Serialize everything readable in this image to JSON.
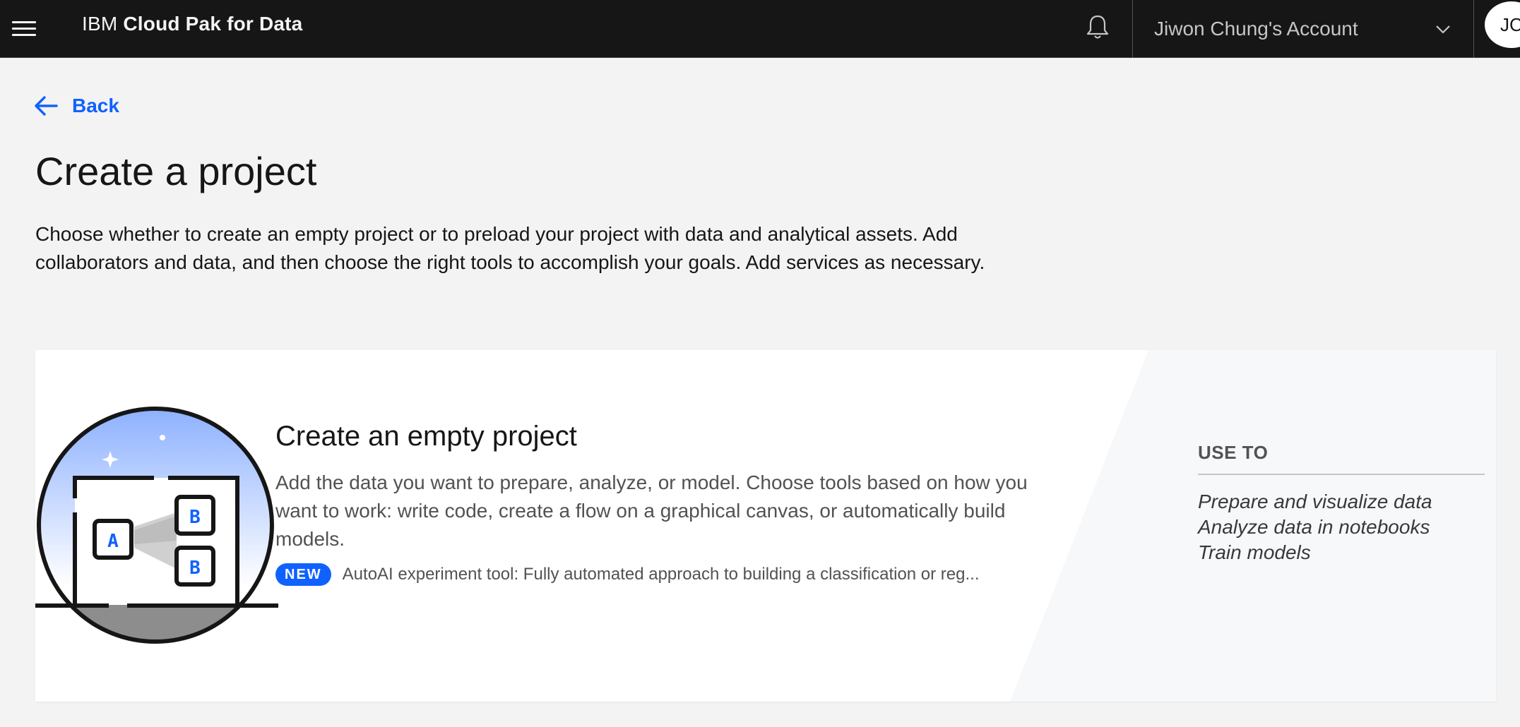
{
  "header": {
    "brand_light": "IBM",
    "brand_bold": "Cloud Pak for Data",
    "account": "Jiwon Chung's Account",
    "avatar_initials": "JC",
    "icons": {
      "menu": "hamburger-menu-icon",
      "notifications": "bell-icon",
      "account_dropdown": "chevron-down-icon"
    }
  },
  "nav": {
    "back_label": "Back"
  },
  "page": {
    "title": "Create a project",
    "intro": "Choose whether to create an empty project or to preload your project with data and analytical assets. Add collaborators and data, and then choose the right tools to accomplish your goals. Add services as necessary."
  },
  "card": {
    "title": "Create an empty project",
    "description": "Add the data you want to prepare, analyze, or model. Choose tools based on how you want to work: write code, create a flow on a graphical canvas, or automatically build models.",
    "badge": "NEW",
    "badge_text": "AutoAI experiment tool: Fully automated approach to building a classification or reg...",
    "use_to_heading": "USE TO",
    "use_to_items": [
      "Prepare and visualize data",
      "Analyze data in notebooks",
      "Train models"
    ],
    "illustration_labels": [
      "A",
      "B",
      "B"
    ]
  },
  "colors": {
    "header_bg": "#161616",
    "page_bg": "#f3f3f3",
    "accent": "#0f62fe",
    "card_bg": "#ffffff"
  }
}
